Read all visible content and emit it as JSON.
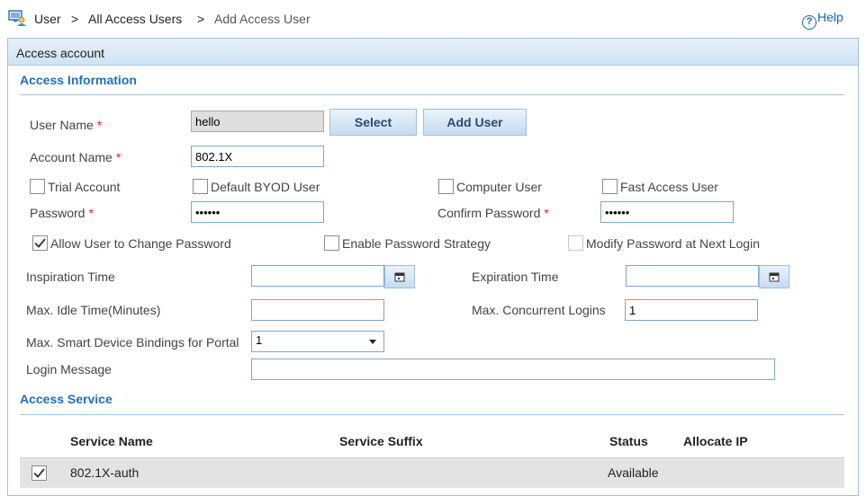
{
  "breadcrumb": {
    "items": [
      "User",
      "All Access Users",
      "Add Access User"
    ],
    "separator": ">"
  },
  "help": {
    "label": "Help"
  },
  "panel": {
    "title": "Access account"
  },
  "access_information": {
    "title": "Access Information",
    "user_name": {
      "label": "User Name",
      "required_mark": "*",
      "value": "hello"
    },
    "select_button": "Select",
    "add_user_button": "Add User",
    "account_name": {
      "label": "Account Name",
      "required_mark": "*",
      "value": "802.1X"
    },
    "checkboxes_row1": [
      {
        "label": "Trial Account",
        "checked": false
      },
      {
        "label": "Default BYOD User",
        "checked": false
      },
      {
        "label": "Computer User",
        "checked": false
      },
      {
        "label": "Fast Access User",
        "checked": false
      }
    ],
    "password": {
      "label": "Password",
      "required_mark": "*",
      "value": "••••••"
    },
    "confirm_password": {
      "label": "Confirm Password",
      "required_mark": "*",
      "value": "••••••"
    },
    "checkboxes_row2": [
      {
        "label": "Allow User to Change Password",
        "checked": true
      },
      {
        "label": "Enable Password Strategy",
        "checked": false
      },
      {
        "label": "Modify Password at Next Login",
        "checked": false,
        "disabled": true
      }
    ],
    "inspiration_time": {
      "label": "Inspiration Time",
      "value": ""
    },
    "expiration_time": {
      "label": "Expiration Time",
      "value": ""
    },
    "max_idle_time": {
      "label": "Max. Idle Time(Minutes)",
      "value": ""
    },
    "max_concurrent_logins": {
      "label": "Max. Concurrent Logins",
      "value": "1"
    },
    "max_smart_device_bindings": {
      "label": "Max. Smart Device Bindings for Portal",
      "value": "1"
    },
    "login_message": {
      "label": "Login Message",
      "value": ""
    }
  },
  "access_service": {
    "title": "Access Service",
    "columns": [
      "Service Name",
      "Service Suffix",
      "Status",
      "Allocate IP"
    ],
    "rows": [
      {
        "checked": true,
        "service_name": "802.1X-auth",
        "service_suffix": "",
        "status": "Available",
        "allocate_ip": ""
      }
    ]
  },
  "colors": {
    "accent": "#1f6fb8",
    "required": "#d9281f",
    "panel_border": "#9fc3e3",
    "row_selected_bg": "#e3e3e3"
  }
}
